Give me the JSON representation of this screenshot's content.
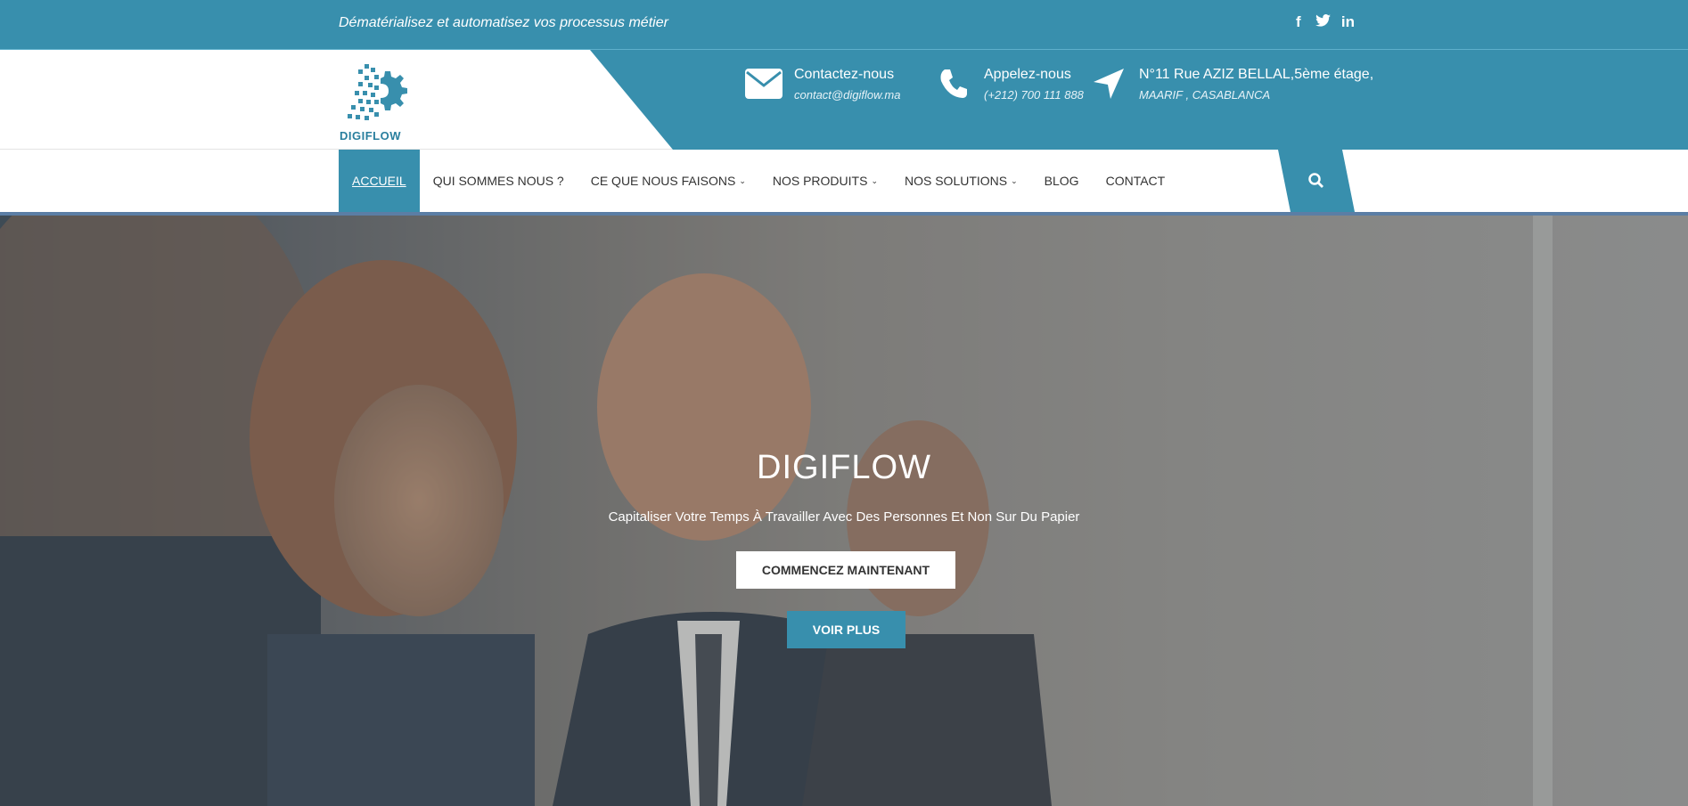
{
  "topbar": {
    "tagline": "Dématérialisez et automatisez vos processus métier",
    "social": [
      {
        "icon": "facebook-icon",
        "glyph": "f"
      },
      {
        "icon": "twitter-icon",
        "glyph": "t"
      },
      {
        "icon": "linkedin-icon",
        "glyph": "in"
      }
    ]
  },
  "logo": {
    "text": "DIGIFLOW"
  },
  "contact": {
    "email": {
      "title": "Contactez-nous",
      "value": "contact@digiflow.ma",
      "icon": "envelope-icon"
    },
    "phone": {
      "title": "Appelez-nous",
      "value": "(+212) 700 111 888",
      "icon": "phone-icon"
    },
    "address": {
      "title": "N°11 Rue AZIZ BELLAL,5ème étage,",
      "value": "MAARIF , CASABLANCA",
      "icon": "location-arrow-icon"
    }
  },
  "nav": {
    "items": [
      {
        "label": "ACCUEIL",
        "active": true
      },
      {
        "label": "QUI SOMMES NOUS ?"
      },
      {
        "label": "CE QUE NOUS FAISONS",
        "dropdown": true
      },
      {
        "label": "NOS PRODUITS",
        "dropdown": true
      },
      {
        "label": "NOS SOLUTIONS",
        "dropdown": true
      },
      {
        "label": "BLOG"
      },
      {
        "label": "CONTACT"
      }
    ],
    "chevron": "⌄",
    "search_icon": "search-icon"
  },
  "hero": {
    "title": "DIGIFLOW",
    "subtitle": "Capitaliser Votre Temps À Travailler Avec Des Personnes Et Non Sur Du Papier",
    "primary_button": "COMMENCEZ MAINTENANT",
    "secondary_button": "VOIR PLUS"
  },
  "colors": {
    "brand": "#388fad",
    "white": "#ffffff",
    "text": "#333333"
  }
}
